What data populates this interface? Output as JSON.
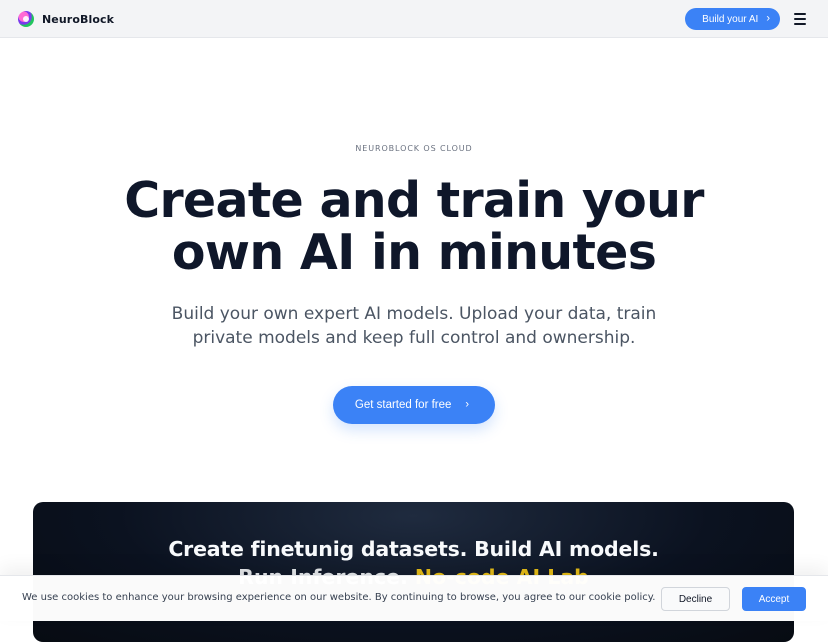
{
  "nav": {
    "brand": "NeuroBlock",
    "build_button": "Build your AI",
    "build_button_chevron": "›",
    "menu_icon": "hamburger-menu-icon"
  },
  "hero": {
    "eyebrow": "NEUROBLOCK OS CLOUD",
    "headline_line1": "Create and train your",
    "headline_line2": "own AI in minutes",
    "subhead_line1": "Build your own expert AI models. Upload your data, train",
    "subhead_line2": "private models and keep full control and ownership.",
    "cta_label": "Get started for free",
    "cta_chevron": "›"
  },
  "dark_section": {
    "line1": "Create finetunig datasets. Build AI models.",
    "line2_prefix": "Run Inference.",
    "line2_highlight": "No-code AI Lab"
  },
  "cookie_banner": {
    "text": "We use cookies to enhance your browsing experience on our website. By continuing to browse, you agree to our cookie policy.",
    "decline": "Decline",
    "accept": "Accept"
  },
  "colors": {
    "accent_blue": "#3b82f6",
    "dark_bg": "#0b1220",
    "highlight_yellow": "#facc15"
  }
}
